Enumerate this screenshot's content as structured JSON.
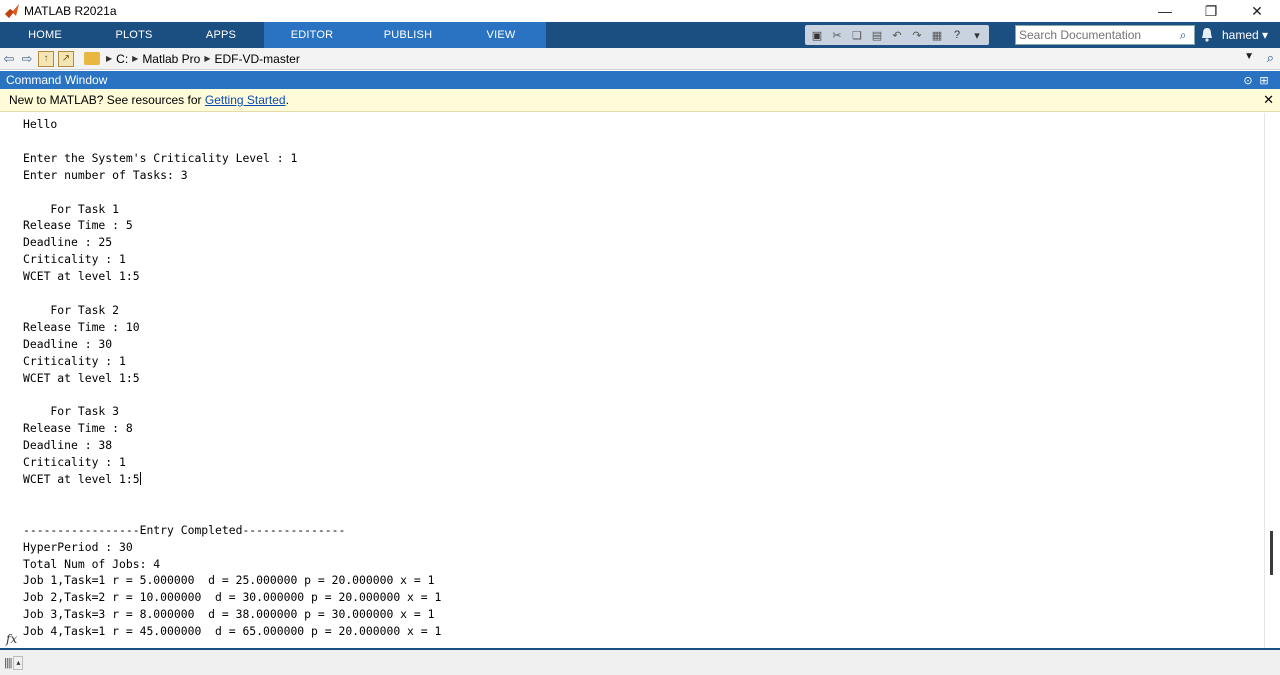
{
  "window": {
    "title": "MATLAB R2021a",
    "minimize": "—",
    "restore": "❐",
    "close": "✕"
  },
  "ribbon": {
    "tabs": [
      {
        "label": "HOME",
        "active": false
      },
      {
        "label": "PLOTS",
        "active": false
      },
      {
        "label": "APPS",
        "active": false
      },
      {
        "label": "EDITOR",
        "active": true
      },
      {
        "label": "PUBLISH",
        "active": true
      },
      {
        "label": "VIEW",
        "active": true
      }
    ],
    "search_placeholder": "Search Documentation",
    "user": "hamed ▾"
  },
  "address": {
    "crumbs": [
      "C:",
      "Matlab Pro",
      "EDF-VD-master"
    ]
  },
  "command_window": {
    "title": "Command Window",
    "banner_prefix": "New to MATLAB? See resources for ",
    "banner_link": "Getting Started",
    "banner_suffix": ".",
    "output": "Hello\n\nEnter the System's Criticality Level : 1\nEnter number of Tasks: 3\n\n    For Task 1\nRelease Time : 5\nDeadline : 25\nCriticality : 1\nWCET at level 1:5\n\n    For Task 2\nRelease Time : 10\nDeadline : 30\nCriticality : 1\nWCET at level 1:5\n\n    For Task 3\nRelease Time : 8\nDeadline : 38\nCriticality : 1\nWCET at level 1:5",
    "output2": "\n\n\n-----------------Entry Completed---------------\nHyperPeriod : 30\nTotal Num of Jobs: 4\nJob 1,Task=1 r = 5.000000  d = 25.000000 p = 20.000000 x = 1\nJob 2,Task=2 r = 10.000000  d = 30.000000 p = 20.000000 x = 1\nJob 3,Task=3 r = 8.000000  d = 38.000000 p = 30.000000 x = 1\nJob 4,Task=1 r = 45.000000  d = 65.000000 p = 20.000000 x = 1",
    "prompt_symbol": "fx"
  },
  "icons": {
    "app_logo": "matlab-logo",
    "back": "arrow-left-icon",
    "forward": "arrow-right-icon",
    "up": "up-folder-icon",
    "browse": "browse-folder-icon",
    "folder": "folder-icon",
    "search": "search-icon",
    "bell": "bell-icon"
  },
  "colors": {
    "ribbon": "#1c4f81",
    "active_tab": "#2a73c2",
    "banner": "#fffbd8"
  }
}
